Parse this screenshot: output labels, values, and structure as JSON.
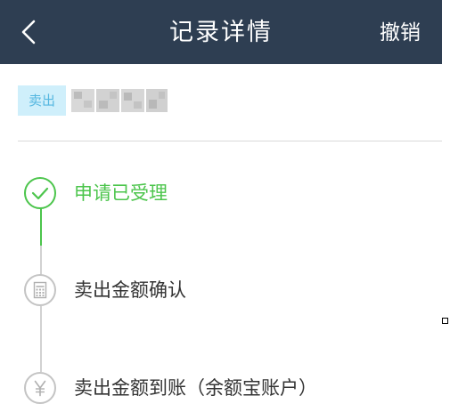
{
  "navbar": {
    "title": "记录详情",
    "action_label": "撤销",
    "background": "#2e3e52"
  },
  "trade": {
    "badge": "卖出",
    "name_obscured": true
  },
  "timeline": {
    "steps": [
      {
        "label": "申请已受理",
        "state": "done",
        "icon": "checkmark-icon"
      },
      {
        "label": "卖出金额确认",
        "state": "pending",
        "icon": "calculator-icon"
      },
      {
        "label": "卖出金额到账（余额宝账户）",
        "state": "pending",
        "icon": "yen-icon"
      }
    ]
  },
  "colors": {
    "done": "#4cc54c",
    "pending_icon": "#c4c4c4",
    "pending_text": "#333333",
    "badge_bg": "#cfeffb",
    "badge_text": "#55b7e0",
    "divider": "#d9d9d9"
  }
}
